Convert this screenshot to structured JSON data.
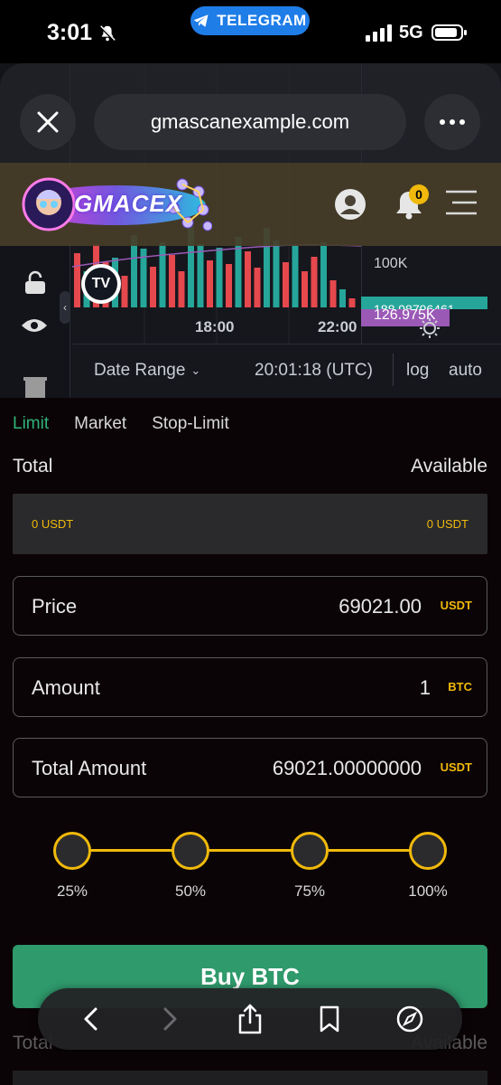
{
  "status_bar": {
    "time": "3:01",
    "telegram_label": "TELEGRAM",
    "network": "5G"
  },
  "browser": {
    "url": "gmascanexample.com"
  },
  "header": {
    "logo_text": "GMACEX",
    "notification_count": "0"
  },
  "chart": {
    "time_labels": [
      "18:00",
      "22:00"
    ],
    "price_tag_purple": "126.975K",
    "price_tag_purple_under": "100K",
    "price_tag_green": "188.98796461",
    "date_range_label": "Date Range",
    "clock": "20:01:18 (UTC)",
    "log_label": "log",
    "auto_label": "auto",
    "bull_color": "#26a69a",
    "bear_color": "#e5484d"
  },
  "order_form": {
    "tabs": [
      "Limit",
      "Market",
      "Stop-Limit"
    ],
    "active_tab": "Limit",
    "total_label": "Total",
    "available_label": "Available",
    "balance_left": "0 USDT",
    "balance_right": "0 USDT",
    "price": {
      "label": "Price",
      "value": "69021.00",
      "unit": "USDT"
    },
    "amount": {
      "label": "Amount",
      "value": "1",
      "unit": "BTC"
    },
    "total_amount": {
      "label": "Total Amount",
      "value": "69021.00000000",
      "unit": "USDT"
    },
    "percent_steps": [
      "25%",
      "50%",
      "75%",
      "100%"
    ],
    "buy_button": "Buy BTC",
    "accent_color": "#f0b90b",
    "buy_color": "#2f9a6c"
  },
  "ghost_form": {
    "total_label": "Total",
    "available_label": "Available"
  },
  "toolbar": {
    "icons": [
      "back-icon",
      "forward-icon",
      "share-icon",
      "bookmarks-icon",
      "compass-icon"
    ]
  }
}
